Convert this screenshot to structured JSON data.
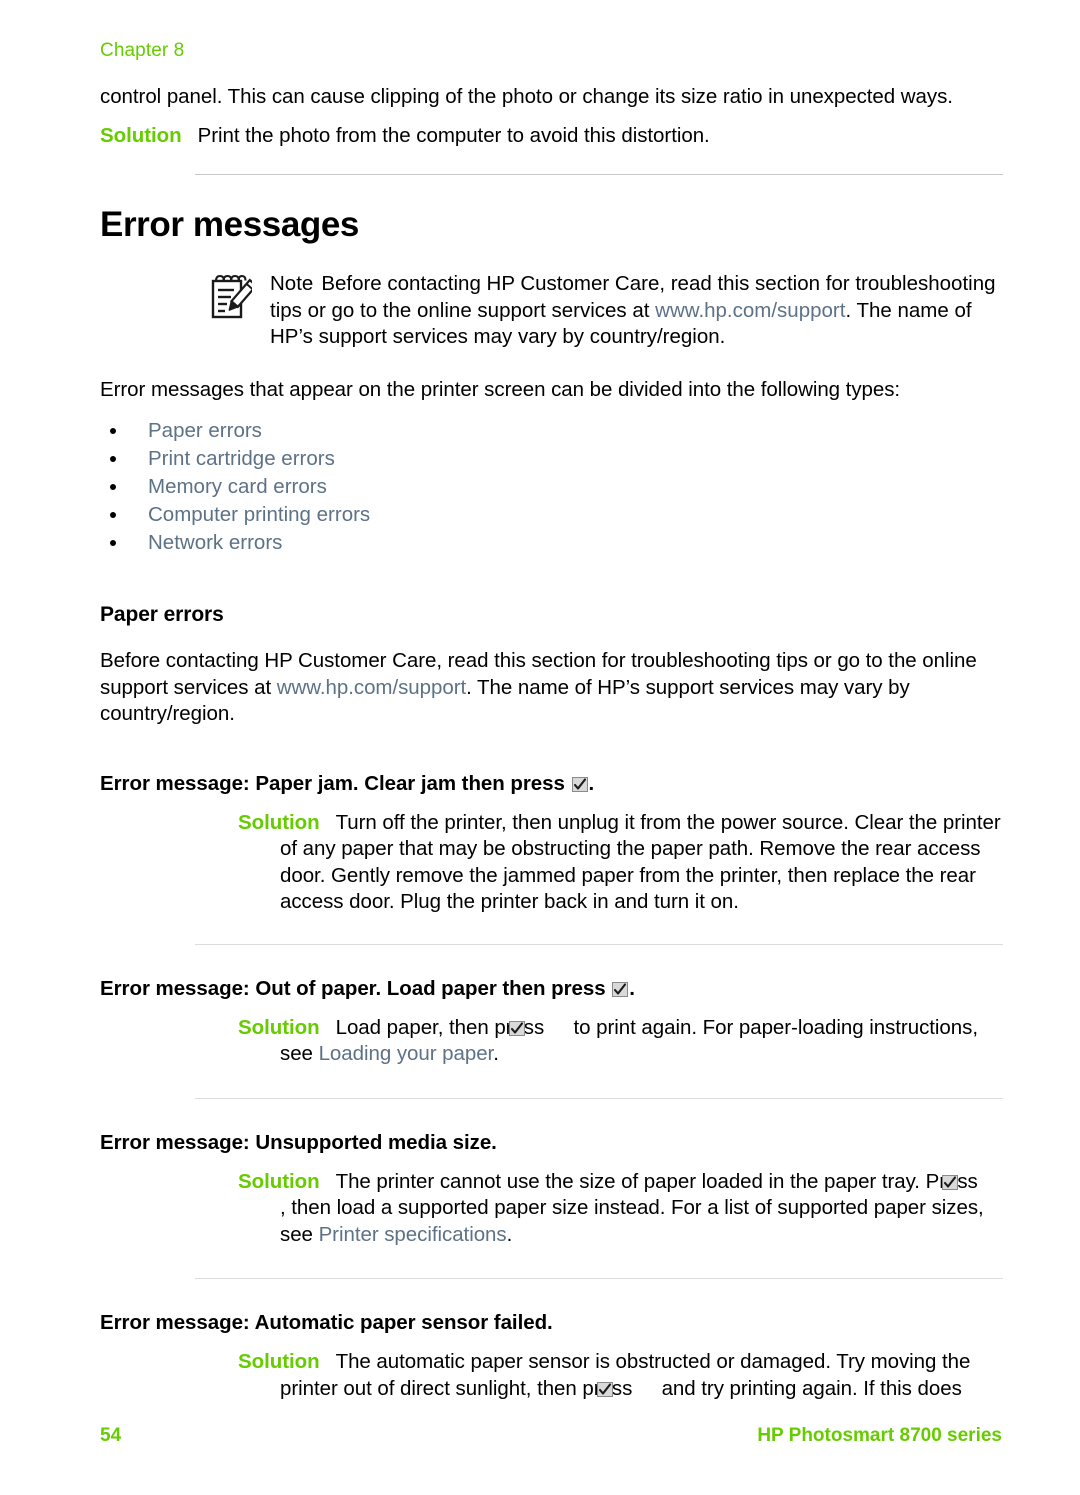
{
  "page": {
    "chapter_header": "Chapter 8",
    "footer_page_number": "54",
    "footer_product": "HP Photosmart 8700 series"
  },
  "colors": {
    "accent_green": "#66cc00",
    "link_slate": "#5d7287",
    "rule_gray": "#c8c8c8",
    "text_black": "#000000"
  },
  "continued_paragraph": {
    "text": "control panel. This can cause clipping of the photo or change its size ratio in unexpected ways.",
    "solution_label": "Solution",
    "solution_text": "Print the photo from the computer to avoid this distortion."
  },
  "heading": {
    "title": "Error messages"
  },
  "note": {
    "icon": "notepad-pencil-icon",
    "label": "Note",
    "text_part1": "Before contacting HP Customer Care, read this section for troubleshooting tips or go to the online support services at ",
    "link": "www.hp.com/support",
    "text_part2": ". The name of HP’s support services may vary by country/region."
  },
  "intro": {
    "text": "Error messages that appear on the printer screen can be divided into the following types:",
    "bullets": [
      "Paper errors",
      "Print cartridge errors",
      "Memory card errors",
      "Computer printing errors",
      "Network errors"
    ]
  },
  "paper_errors": {
    "section_title": "Paper errors",
    "intro_part1": "Before contacting HP Customer Care, read this section for troubleshooting tips or go to the online support services at ",
    "intro_link": "www.hp.com/support",
    "intro_part2": ". The name of HP’s support services may vary by country/region.",
    "entries": [
      {
        "title_prefix": "Error message: Paper jam. Clear jam then press ",
        "title_icon": "ok-button-icon",
        "title_suffix": ".",
        "solution_label": "Solution",
        "solution_text": "Turn off the printer, then unplug it from the power source. Clear the printer of any paper that may be obstructing the paper path. Remove the rear access door. Gently remove the jammed paper from the printer, then replace the rear access door. Plug the printer back in and turn it on."
      },
      {
        "title_prefix": "Error message: Out of paper. Load paper then press ",
        "title_icon": "ok-button-icon",
        "title_suffix": ".",
        "solution_label": "Solution",
        "solution_a": "Load paper, then press ",
        "solution_icon": "ok-button-icon",
        "solution_b": " to print again. For paper-loading instructions, see ",
        "solution_link": "Loading your paper",
        "solution_c": "."
      },
      {
        "title_prefix": "Error message: Unsupported media size.",
        "title_icon": "",
        "title_suffix": "",
        "solution_label": "Solution",
        "solution_a": "The printer cannot use the size of paper loaded in the paper tray. Press ",
        "solution_icon": "ok-button-icon",
        "solution_b": ", then load a supported paper size instead. For a list of supported paper sizes, see ",
        "solution_link": "Printer specifications",
        "solution_c": "."
      },
      {
        "title_prefix": "Error message: Automatic paper sensor failed.",
        "title_icon": "",
        "title_suffix": "",
        "solution_label": "Solution",
        "solution_a": "The automatic paper sensor is obstructed or damaged. Try moving the printer out of direct sunlight, then press ",
        "solution_icon": "ok-button-icon",
        "solution_b": " and try printing again. If this does",
        "solution_link": "",
        "solution_c": ""
      }
    ]
  }
}
